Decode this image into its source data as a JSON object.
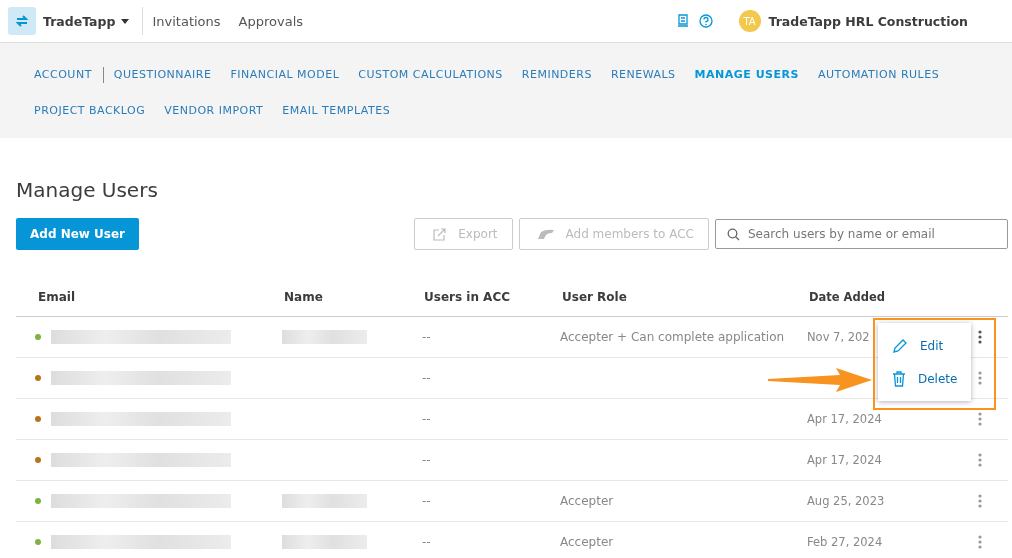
{
  "header": {
    "app_name": "TradeTapp",
    "links": [
      "Invitations",
      "Approvals"
    ],
    "avatar_initials": "TA",
    "company": "TradeTapp HRL Construction"
  },
  "nav_tabs": [
    {
      "label": "ACCOUNT",
      "selected": false,
      "separator_after": true
    },
    {
      "label": "QUESTIONNAIRE",
      "selected": false,
      "separator_after": false
    },
    {
      "label": "FINANCIAL MODEL",
      "selected": false,
      "separator_after": false
    },
    {
      "label": "CUSTOM CALCULATIONS",
      "selected": false,
      "separator_after": false
    },
    {
      "label": "REMINDERS",
      "selected": false,
      "separator_after": false
    },
    {
      "label": "RENEWALS",
      "selected": false,
      "separator_after": false
    },
    {
      "label": "MANAGE USERS",
      "selected": true,
      "separator_after": false
    },
    {
      "label": "AUTOMATION RULES",
      "selected": false,
      "separator_after": false
    },
    {
      "label": "PROJECT BACKLOG",
      "selected": false,
      "separator_after": false
    },
    {
      "label": "VENDOR IMPORT",
      "selected": false,
      "separator_after": false
    },
    {
      "label": "EMAIL TEMPLATES",
      "selected": false,
      "separator_after": false
    }
  ],
  "page_title": "Manage Users",
  "toolbar": {
    "add_button": "Add New User",
    "export_button": {
      "label": "Export",
      "disabled": true
    },
    "acc_button": {
      "label": "Add members to ACC",
      "disabled": true
    },
    "search": {
      "placeholder": "Search users by name or email"
    }
  },
  "table": {
    "columns": [
      "Email",
      "Name",
      "Users in ACC",
      "User Role",
      "Date Added"
    ],
    "rows": [
      {
        "color": "#7cb342",
        "email_redacted": true,
        "name_redacted": true,
        "acc": "--",
        "role": "Accepter + Can complete application",
        "date": "Nov 7, 202"
      },
      {
        "color": "#b8731b",
        "email_redacted": true,
        "name_redacted": false,
        "acc": "--",
        "role": "",
        "date": ""
      },
      {
        "color": "#b8731b",
        "email_redacted": true,
        "name_redacted": false,
        "acc": "--",
        "role": "",
        "date": "Apr 17, 2024"
      },
      {
        "color": "#b8731b",
        "email_redacted": true,
        "name_redacted": false,
        "acc": "--",
        "role": "",
        "date": "Apr 17, 2024"
      },
      {
        "color": "#7cb342",
        "email_redacted": true,
        "name_redacted": true,
        "acc": "--",
        "role": "Accepter",
        "date": "Aug 25, 2023"
      },
      {
        "color": "#7cb342",
        "email_redacted": true,
        "name_redacted": true,
        "acc": "--",
        "role": "Accepter",
        "date": "Feb 27, 2024"
      }
    ]
  },
  "row_menu": {
    "items": [
      {
        "kind": "edit",
        "label": "Edit"
      },
      {
        "kind": "delete",
        "label": "Delete"
      }
    ]
  }
}
